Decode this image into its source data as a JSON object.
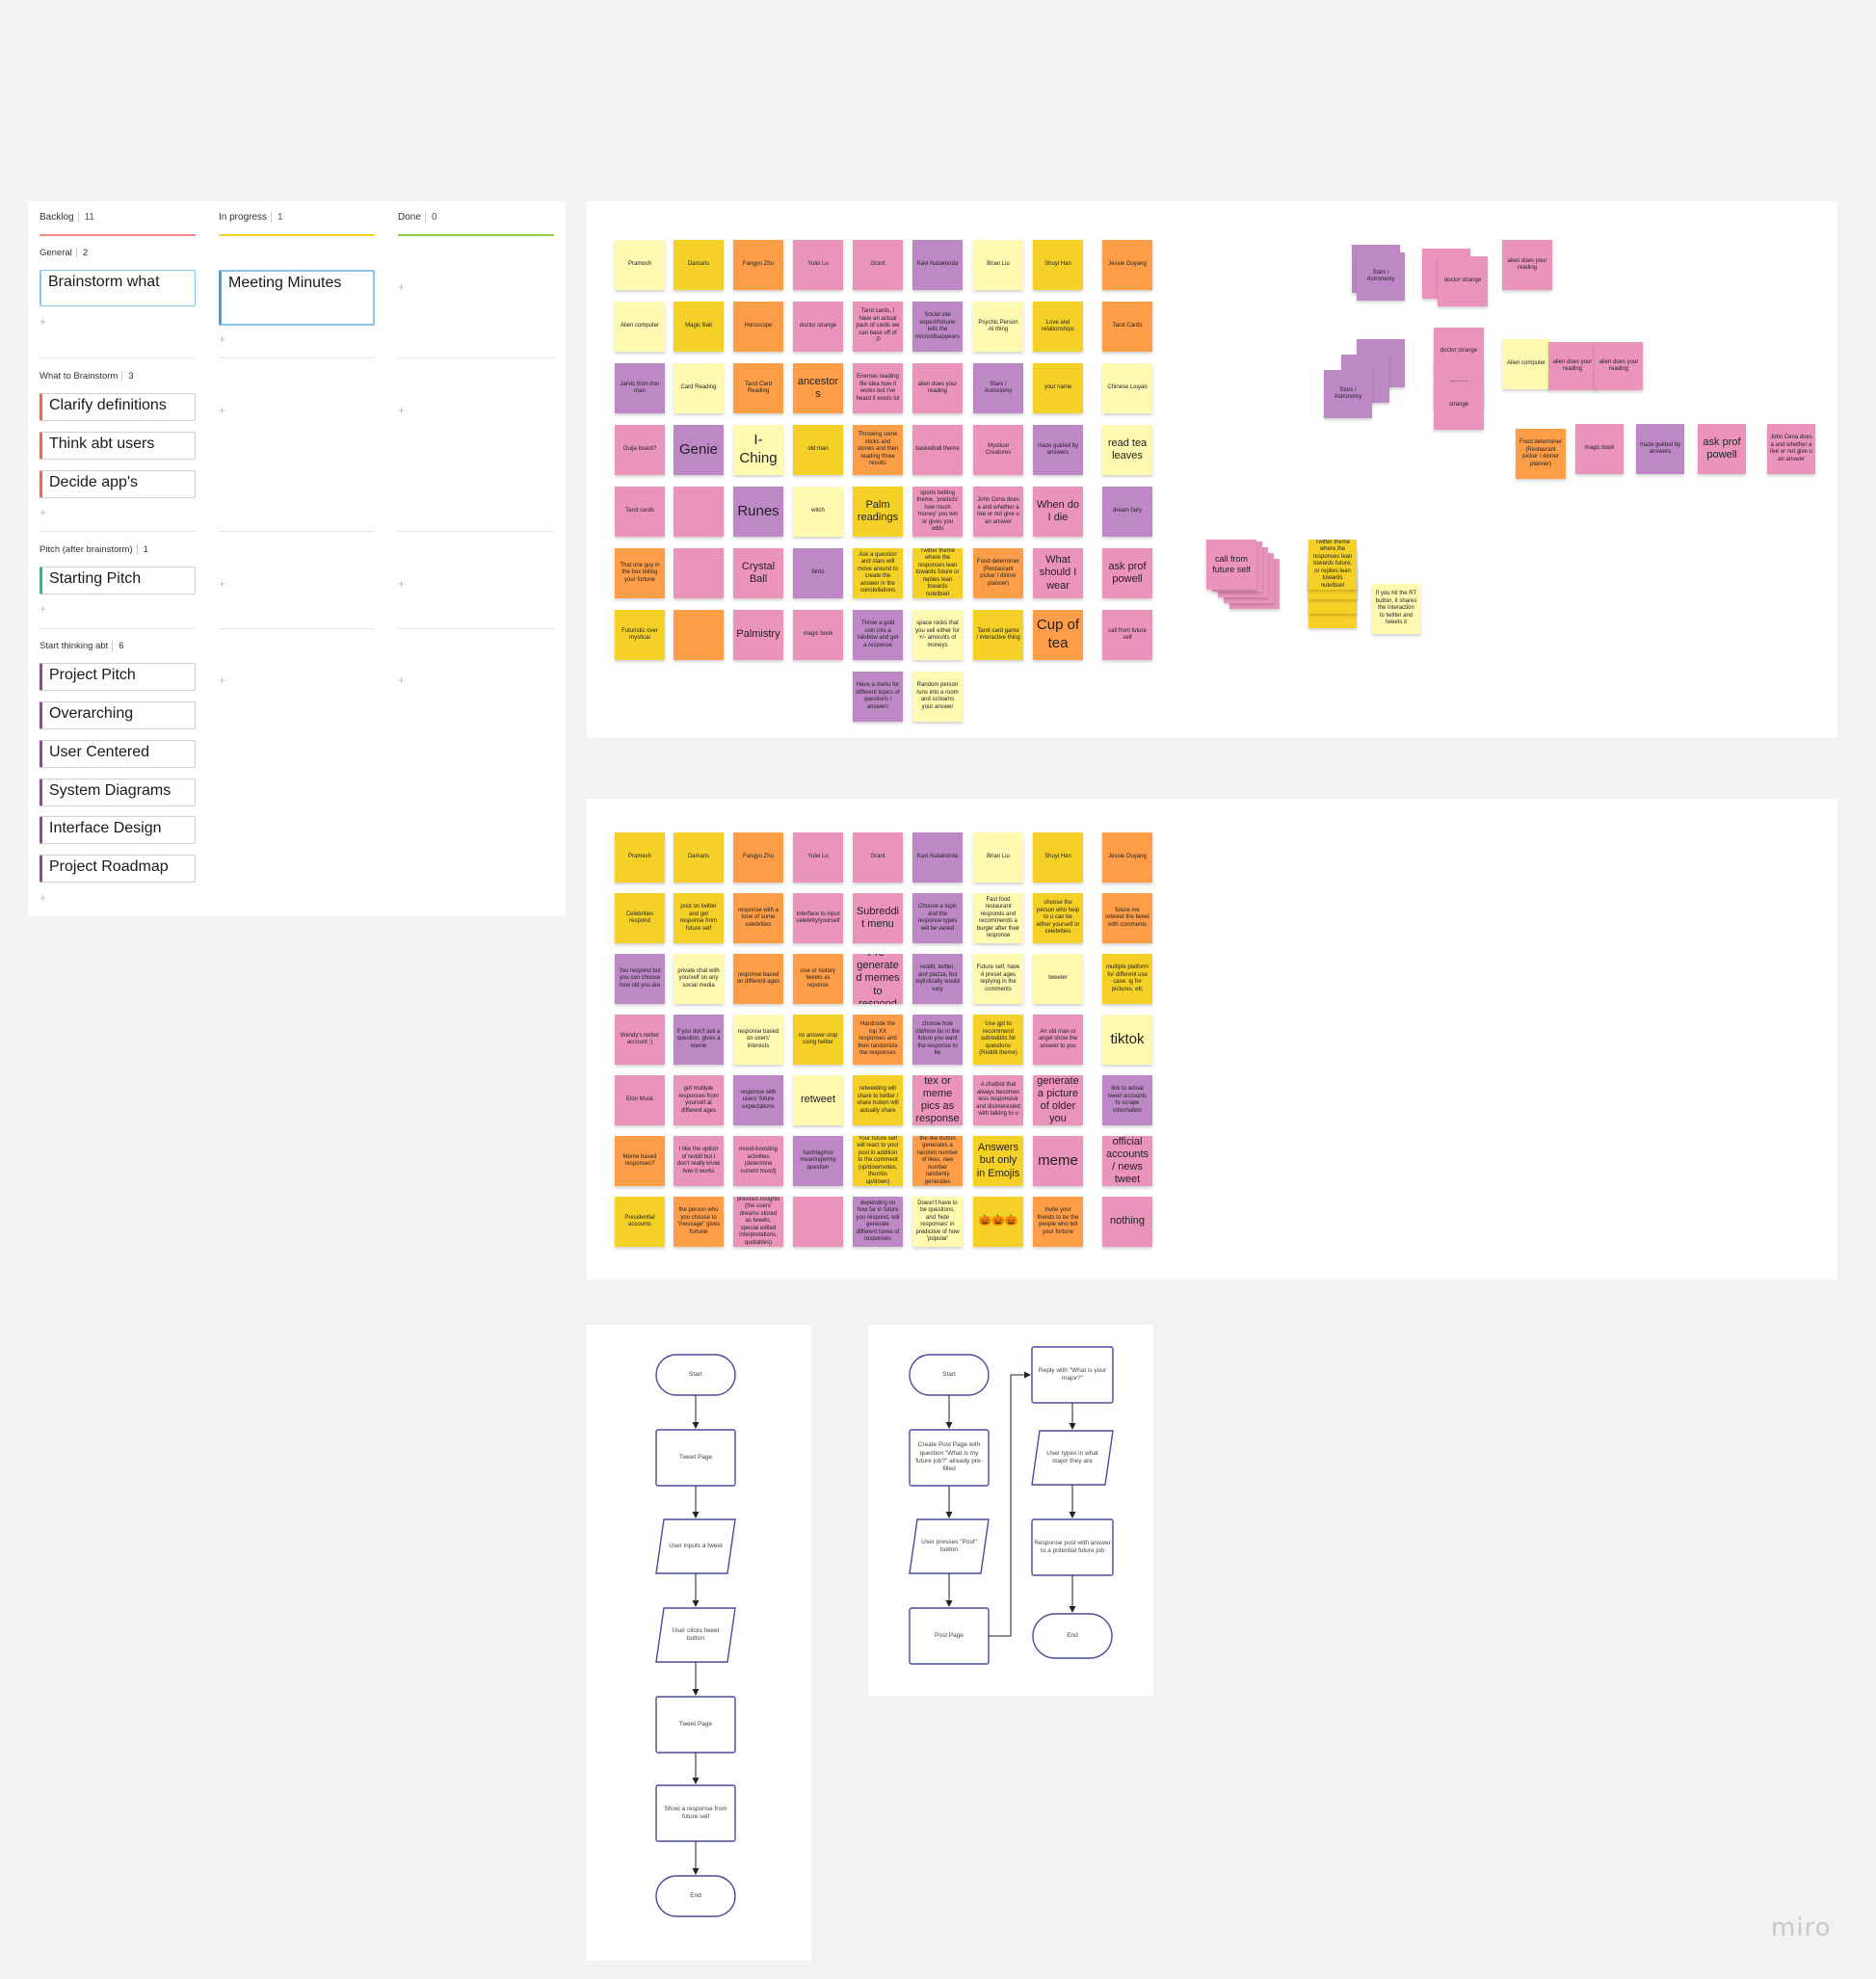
{
  "kanban": {
    "columns": [
      {
        "title": "Backlog",
        "count": "11",
        "color": "#f28b82"
      },
      {
        "title": "In progress",
        "count": "1",
        "color": "#f5d128"
      },
      {
        "title": "Done",
        "count": "0",
        "color": "#8fd14f"
      }
    ],
    "groups": [
      {
        "title": "General",
        "count": "2"
      },
      {
        "title": "What to Brainstorm",
        "count": "3"
      },
      {
        "title": "Pitch (after brainstorm)",
        "count": "1"
      },
      {
        "title": "Start thinking abt",
        "count": "6"
      }
    ],
    "cards": {
      "brainstorm": "Brainstorm what",
      "meeting": "Meeting Minutes",
      "clarify": "Clarify definitions",
      "think": "Think abt users",
      "decide": "Decide app's",
      "starting_pitch": "Starting Pitch",
      "project_pitch": "Project Pitch",
      "overarching": "Overarching",
      "user_centered": "User Centered",
      "system_diagrams": "System Diagrams",
      "interface_design": "Interface Design",
      "project_roadmap": "Project Roadmap"
    },
    "plus": "+"
  },
  "board1": {
    "columns": [
      [
        {
          "t": "Pramesh",
          "c": "lyellow"
        },
        {
          "t": "Alien computer",
          "c": "lyellow"
        },
        {
          "t": "Jarvis from iron man",
          "c": "purple"
        },
        {
          "t": "Ouija board?",
          "c": "pink"
        },
        {
          "t": "Tarot cards",
          "c": "pink"
        },
        {
          "t": "That one guy in the box telling your fortune",
          "c": "orange"
        },
        {
          "t": "Futuristic over mystical",
          "c": "yellow"
        }
      ],
      [
        {
          "t": "Damaris",
          "c": "yellow"
        },
        {
          "t": "Magic Ball",
          "c": "yellow"
        },
        {
          "t": "Card Reading",
          "c": "lyellow"
        },
        {
          "t": "Genie",
          "c": "purple",
          "s": "huge"
        },
        {
          "t": "",
          "c": "pink"
        },
        {
          "t": "",
          "c": "pink"
        },
        {
          "t": "",
          "c": "orange"
        }
      ],
      [
        {
          "t": "Fangyu Zhu",
          "c": "orange"
        },
        {
          "t": "Horoscope",
          "c": "orange"
        },
        {
          "t": "Tarot Card Reading",
          "c": "orange"
        },
        {
          "t": "I-Ching",
          "c": "lyellow",
          "s": "huge"
        },
        {
          "t": "Runes",
          "c": "purple",
          "s": "huge"
        },
        {
          "t": "Crystal Ball",
          "c": "pink",
          "s": "big"
        },
        {
          "t": "Palmistry",
          "c": "pink",
          "s": "big"
        }
      ],
      [
        {
          "t": "Yulei Lu",
          "c": "pink"
        },
        {
          "t": "doctor strange",
          "c": "pink"
        },
        {
          "t": "ancestors",
          "c": "orange",
          "s": "big"
        },
        {
          "t": "old man",
          "c": "yellow"
        },
        {
          "t": "witch",
          "c": "lyellow"
        },
        {
          "t": "birds",
          "c": "purple"
        },
        {
          "t": "magic book",
          "c": "pink"
        }
      ],
      [
        {
          "t": "Grant",
          "c": "pink"
        },
        {
          "t": "Tarot cards, I have an actual pack of cards we can base off of :P",
          "c": "pink"
        },
        {
          "t": "Enemas reading file idea how it works but I've heard it exists lol",
          "c": "pink"
        },
        {
          "t": "Throwing some sticks and stones and then reading three results",
          "c": "orange"
        },
        {
          "t": "Palm readings",
          "c": "yellow",
          "s": "big"
        },
        {
          "t": "Ask a question and stars will move around to create the answer in the constellations",
          "c": "yellow"
        },
        {
          "t": "Throw a gold coin into a rainbow and get a response",
          "c": "purple"
        },
        {
          "t": "Have a menu for different topics of questions / answers",
          "c": "purple"
        }
      ],
      [
        {
          "t": "Kavi Natakonda",
          "c": "purple"
        },
        {
          "t": "Social site expert/fortune tells the micro/disappears",
          "c": "purple"
        },
        {
          "t": "alien does your reading",
          "c": "pink"
        },
        {
          "t": "basketball theme",
          "c": "pink"
        },
        {
          "t": "sports betting theme, 'predicts' how much 'money' you win or gives you odds",
          "c": "pink"
        },
        {
          "t": "Twitter theme where the responses lean towards future or replies lean towards nutelbset",
          "c": "yellow"
        },
        {
          "t": "space rocks that you sell either for +/- amounts of moneys",
          "c": "lyellow"
        },
        {
          "t": "Random person runs into a room and screams your answer",
          "c": "lyellow"
        }
      ],
      [
        {
          "t": "Brian Liu",
          "c": "lyellow"
        },
        {
          "t": "Psychic Person AI thing",
          "c": "lyellow"
        },
        {
          "t": "Stars / Astronomy",
          "c": "purple"
        },
        {
          "t": "Mystical Creatures",
          "c": "pink"
        },
        {
          "t": "John Cena does a and whether a live or not give u an answer",
          "c": "pink"
        },
        {
          "t": "Food determiner (Restaurant picker / dinner planner)",
          "c": "orange"
        },
        {
          "t": "Tarot card game / interactive thing",
          "c": "yellow"
        }
      ],
      [
        {
          "t": "Shuyi Han",
          "c": "yellow"
        },
        {
          "t": "Love and relationships",
          "c": "yellow"
        },
        {
          "t": "your name",
          "c": "yellow"
        },
        {
          "t": "maze guided by answers",
          "c": "purple"
        },
        {
          "t": "When do I die",
          "c": "pink",
          "s": "big"
        },
        {
          "t": "What should I wear",
          "c": "pink",
          "s": "big"
        },
        {
          "t": "Cup of tea",
          "c": "orange",
          "s": "huge"
        }
      ],
      [
        {
          "t": "Jessie Ouyang",
          "c": "orange"
        },
        {
          "t": "Tarot Cards",
          "c": "orange"
        },
        {
          "t": "Chinese Liuyao",
          "c": "lyellow"
        },
        {
          "t": "read tea leaves",
          "c": "lyellow",
          "s": "big"
        },
        {
          "t": "dream fairy",
          "c": "purple"
        },
        {
          "t": "ask prof powell",
          "c": "pink",
          "s": "big"
        },
        {
          "t": "call from future self",
          "c": "pink"
        }
      ]
    ],
    "clusters": {
      "stars_a": "Stars / Astronomy",
      "doctor_a": "doctor strange",
      "alien_a": "alien does your reading",
      "doctor_b": "doctor strange",
      "strange_c": "strange",
      "strange_d": "strange",
      "stars_b": "Stars / Astronomy",
      "alien_computer": "Alien computer",
      "alien_b": "alien does your reading",
      "alien_c": "alien does your reading",
      "food": "Food determiner (Restaurant picker / dinner planner)",
      "magic_book": "magic book",
      "maze": "maze guided by answers",
      "ask_prof": "ask prof powell",
      "john_cena": "John Cena does a and whether a live or not give u an answer",
      "call_future": "call from future self",
      "twitter_theme": "Twitter theme where the responses lean towards future, or replies lean towards nutelbset",
      "retweet_note": "If you hit the RT button, it shares the interaction to twitter and tweets it"
    }
  },
  "board2": {
    "columns": [
      [
        {
          "t": "Pramesh",
          "c": "yellow"
        },
        {
          "t": "Celebrities respond",
          "c": "yellow"
        },
        {
          "t": "You respond but you can choose how old you are",
          "c": "purple"
        },
        {
          "t": "Wendy's twitter account :)",
          "c": "pink"
        },
        {
          "t": "Elon Musk",
          "c": "pink"
        },
        {
          "t": "Meme based responses?",
          "c": "orange"
        },
        {
          "t": "Presidential accounts",
          "c": "yellow"
        }
      ],
      [
        {
          "t": "Damaris",
          "c": "yellow"
        },
        {
          "t": "post on twitter and get response from future self",
          "c": "yellow"
        },
        {
          "t": "private chat with yourself on any social media",
          "c": "lyellow"
        },
        {
          "t": "If you don't ask a question, gives a meme",
          "c": "purple"
        },
        {
          "t": "get multiple responses from yourself at different ages",
          "c": "pink"
        },
        {
          "t": "I like the option of reddit but I don't really know how it works",
          "c": "pink"
        },
        {
          "t": "the person who you choose to \"message\" gives fortune",
          "c": "orange"
        }
      ],
      [
        {
          "t": "Fangyu Zhu",
          "c": "orange"
        },
        {
          "t": "response with a tone of some celebrities",
          "c": "orange"
        },
        {
          "t": "response based on different ages",
          "c": "orange"
        },
        {
          "t": "response based on users' interests",
          "c": "lyellow"
        },
        {
          "t": "response with users' future expectations",
          "c": "purple"
        },
        {
          "t": "mood-boosting activities (determine current mood)",
          "c": "pink"
        },
        {
          "t": "previous insights (the users' dreams stored as tweets, special edited interpretations, quotables)",
          "c": "pink"
        }
      ],
      [
        {
          "t": "Yulei Lu",
          "c": "pink"
        },
        {
          "t": "Interface to input celebrity/yourself",
          "c": "pink"
        },
        {
          "t": "use ur history tweets as reponse",
          "c": "orange"
        },
        {
          "t": "no answer-stop using twitter",
          "c": "yellow"
        },
        {
          "t": "retweet",
          "c": "lyellow",
          "s": "big"
        },
        {
          "t": "hashtag#no meaningwrmy question",
          "c": "purple"
        },
        {
          "t": "",
          "c": "pink"
        }
      ],
      [
        {
          "t": "Grant",
          "c": "pink"
        },
        {
          "t": "Subreddit menu",
          "c": "pink",
          "s": "big"
        },
        {
          "t": "Pre-generated memes to respond",
          "c": "pink",
          "s": "big"
        },
        {
          "t": "Hardcode the top XX responses and then randomize the responses",
          "c": "orange"
        },
        {
          "t": "retweeting will share to twitter / share button will actually share",
          "c": "yellow"
        },
        {
          "t": "Your future self will react to your post in addition to the comment (up/downvotes, thumbs up/down)",
          "c": "yellow"
        },
        {
          "t": "depending on how far in future you respond, will generate different tones of responses",
          "c": "purple"
        }
      ],
      [
        {
          "t": "Kavi Natakonda",
          "c": "purple"
        },
        {
          "t": "Choose a topic and the response types will be varied",
          "c": "purple"
        },
        {
          "t": "reddit, twitter, and piazza, but stylistically would vary",
          "c": "purple"
        },
        {
          "t": "choose how old/how far in the future you want the response to be",
          "c": "purple"
        },
        {
          "t": "choose tex or meme pics as responses",
          "c": "pink",
          "s": "big"
        },
        {
          "t": "the like button generates a random number of likes, new number randomly generates",
          "c": "orange"
        },
        {
          "t": "Doesn't have to be questions, and 'hide responses' in predictive of how 'popular'",
          "c": "lyellow"
        }
      ],
      [
        {
          "t": "Brian Liu",
          "c": "lyellow"
        },
        {
          "t": "Fast food restaurant responds and recommends a burger after their response",
          "c": "lyellow"
        },
        {
          "t": "Future self, have 4 preset ages replying in the comments",
          "c": "lyellow"
        },
        {
          "t": "Use gpt to recommend subreddits for questions (Reddit theme)",
          "c": "yellow"
        },
        {
          "t": "A chatbot that always becomes less responsive and disinterested with talking to u",
          "c": "pink"
        },
        {
          "t": "Answers but only in Emojis",
          "c": "yellow",
          "s": "big"
        },
        {
          "t": "🎃🎃🎃",
          "c": "yellow",
          "s": "big"
        }
      ],
      [
        {
          "t": "Shuyi Han",
          "c": "yellow"
        },
        {
          "t": "choose the person who help to u can be either yourself or celebrities",
          "c": "yellow"
        },
        {
          "t": "tweeter",
          "c": "lyellow"
        },
        {
          "t": "An old man or angel show the answer to you",
          "c": "pink"
        },
        {
          "t": "generate a picture of older you",
          "c": "pink",
          "s": "big"
        },
        {
          "t": "meme",
          "c": "pink",
          "s": "huge"
        },
        {
          "t": "invite your friends to be the people who tell your fortune",
          "c": "orange"
        }
      ],
      [
        {
          "t": "Jessie Ouyang",
          "c": "orange"
        },
        {
          "t": "future me retweet the tweet with comments",
          "c": "orange"
        },
        {
          "t": "multiple platform for different use case. ig for pictures, etc",
          "c": "yellow"
        },
        {
          "t": "tiktok",
          "c": "lyellow",
          "s": "huge"
        },
        {
          "t": "link to actual tweet accounts to scrape information",
          "c": "purple"
        },
        {
          "t": "official accounts / news tweet",
          "c": "pink",
          "s": "big"
        },
        {
          "t": "nothing",
          "c": "pink",
          "s": "big"
        }
      ]
    ]
  },
  "flow1": {
    "nodes": [
      "Start",
      "Tweet Page",
      "User inputs a tweet",
      "User clicks tweet button",
      "Tweet Page",
      "Show a response from future self",
      "End"
    ]
  },
  "flow2": {
    "nodes": [
      "Start",
      "Create Post Page with question \"What is my future job?\" already pre-filled",
      "User presses \"Post\" button",
      "Post Page",
      "Reply with \"What is your major?\"",
      "User types in what major they are",
      "Response post with answer to a potential future job",
      "End"
    ]
  },
  "logo": "miro",
  "colors": {
    "yellow": "#f5d128",
    "lyellow": "#fff9b1",
    "orange": "#ff9d48",
    "pink": "#ea94bb",
    "purple": "#be88c7",
    "flow_stroke": "#4b4b9a"
  }
}
